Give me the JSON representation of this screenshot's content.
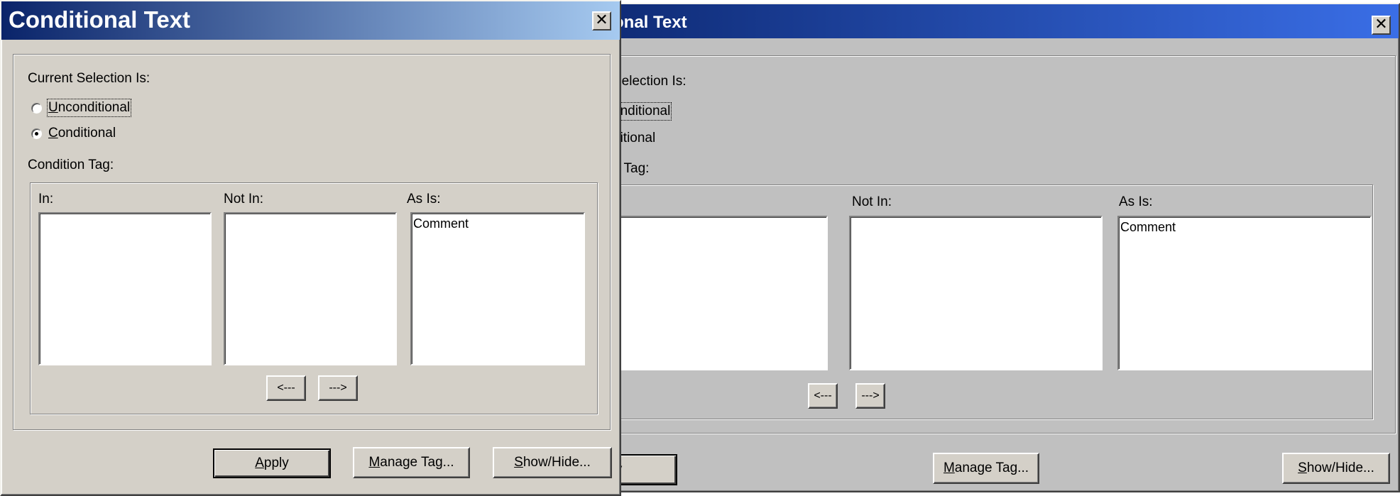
{
  "dialog": {
    "title": "Conditional Text",
    "close": "✕",
    "selection_label": "Current Selection Is:",
    "radio_unconditional_u": "U",
    "radio_unconditional_rest": "nconditional",
    "radio_conditional_u": "C",
    "radio_conditional_rest": "onditional",
    "condition_tag_label": "Condition Tag:",
    "col_in": "In:",
    "col_not_in": "Not In:",
    "col_as_is": "As Is:",
    "as_is_items": [
      "Comment"
    ],
    "move_left": "<---",
    "move_right": "--->",
    "apply_u": "A",
    "apply_rest": "pply",
    "manage_u": "M",
    "manage_rest": "anage Tag...",
    "showhide_u": "S",
    "showhide_rest": "how/Hide..."
  },
  "back_dialog": {
    "title_visible": "onal Text",
    "selection_fragment": "Selection Is:",
    "unconditional_fragment": "onditional",
    "conditional_fragment": "ditional",
    "tag_fragment": "n Tag:",
    "apply_fragment": "ply"
  },
  "colors": {
    "front_title_start": "#0a246a",
    "front_title_end": "#a6caf0",
    "back_title_start": "#0a246a",
    "back_title_end": "#3a6ee6",
    "front_face": "#d4d0c8",
    "back_face": "#c0c0c0"
  }
}
